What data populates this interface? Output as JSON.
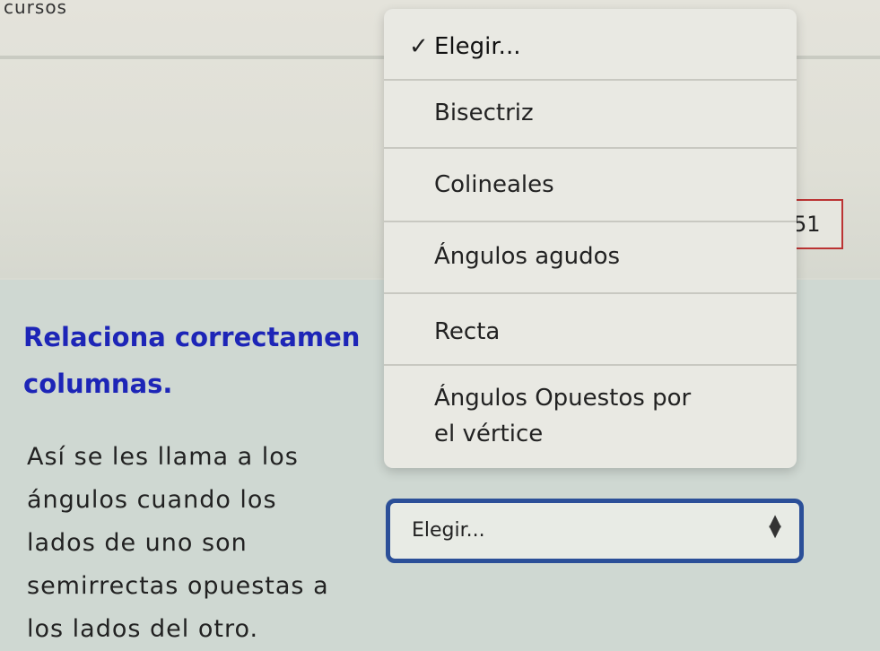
{
  "app": {
    "label": "cursos"
  },
  "question": {
    "number": "51",
    "title_line1": "Relaciona correctamen",
    "title_line2": "columnas.",
    "body_lines": [
      "Así se les llama a los",
      "ángulos cuando los",
      "lados de uno son",
      "semirrectas opuestas a",
      "los lados del otro."
    ]
  },
  "dropdown": {
    "options": [
      {
        "label": "Elegir...",
        "selected": true
      },
      {
        "label": "Bisectriz"
      },
      {
        "label": "Colineales"
      },
      {
        "label": "Ángulos agudos"
      },
      {
        "label": "Recta"
      },
      {
        "label_line1": "Ángulos Opuestos por",
        "label_line2": "el vértice"
      }
    ],
    "check_icon": "checkmark-icon"
  },
  "select": {
    "value": "Elegir...",
    "arrow_icon": "updown-arrows-icon"
  }
}
